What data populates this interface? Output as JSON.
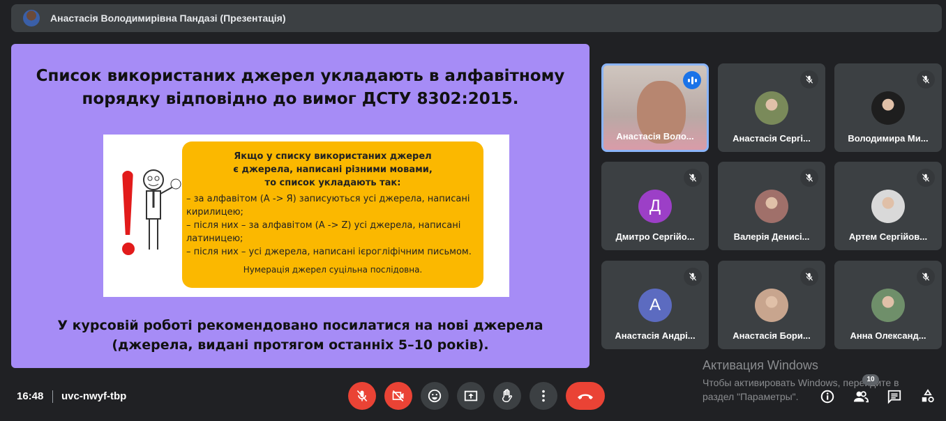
{
  "header": {
    "presenter_title": "Анастасія Володимирівна Пандазі (Презентація)"
  },
  "slide": {
    "title_line1": "Список використаних джерел укладають в алфавітному",
    "title_line2": "порядку відповідно до вимог ДСТУ 8302:2015.",
    "box_head": [
      "Якщо у списку використаних джерел",
      "є джерела, написані різними мовами,",
      "то список укладають так:"
    ],
    "box_items": [
      "– за алфавітом (А -> Я) записуються усі джерела, написані кирилицею;",
      "– після них – за алфавітом (A -> Z) усі джерела, написані латиницею;",
      "– після них – усі джерела, написані ієрогліфічним письмом."
    ],
    "box_foot": "Нумерація джерел суцільна послідовна.",
    "footer_line1": "У курсовій роботі рекомендовано посилатися на нові джерела",
    "footer_line2": "(джерела, видані протягом останніх 5–10 років)."
  },
  "participants": [
    {
      "name": "Анастасія Воло...",
      "type": "video",
      "speaking": true
    },
    {
      "name": "Анастасія Сергі...",
      "type": "photo",
      "color": "#7a8a5a"
    },
    {
      "name": "Володимира Ми...",
      "type": "photo",
      "color": "#1e1e1e"
    },
    {
      "name": "Дмитро Сергійо...",
      "type": "letter",
      "letter": "Д",
      "color": "#9c3fc7"
    },
    {
      "name": "Валерія Денисі...",
      "type": "photo",
      "color": "#a0706a"
    },
    {
      "name": "Артем Сергійов...",
      "type": "photo",
      "color": "#d9d9d9"
    },
    {
      "name": "Анастасія Андрі...",
      "type": "letter",
      "letter": "А",
      "color": "#5c6bc0"
    },
    {
      "name": "Анастасія Бори...",
      "type": "photo",
      "color": "#c8a58e"
    },
    {
      "name": "Анна Олександ...",
      "type": "photo",
      "color": "#6f8f6a"
    }
  ],
  "footer": {
    "time": "16:48",
    "meeting_code": "uvc-nwyf-tbp",
    "participant_count": "10"
  },
  "watermark": {
    "title": "Активация Windows",
    "text": "Чтобы активировать Windows, перейдите в раздел \"Параметры\"."
  },
  "colors": {
    "danger": "#ea4335",
    "accent": "#1a73e8",
    "slide_bg": "#a68cf6",
    "box": "#fbb800"
  }
}
